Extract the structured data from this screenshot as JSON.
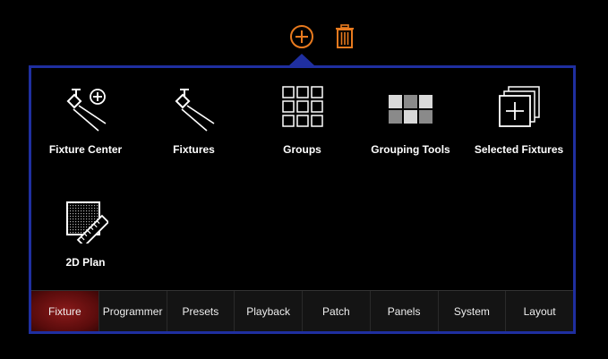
{
  "toolbar": {
    "add_icon": "add-circle-icon",
    "delete_icon": "trash-icon",
    "accent_color": "#e87a1e"
  },
  "panel": {
    "border_color": "#1f2fa0",
    "tiles": [
      {
        "label": "Fixture Center",
        "icon": "fixture-center-icon"
      },
      {
        "label": "Fixtures",
        "icon": "fixtures-icon"
      },
      {
        "label": "Groups",
        "icon": "groups-icon"
      },
      {
        "label": "Grouping Tools",
        "icon": "grouping-tools-icon"
      },
      {
        "label": "Selected Fixtures",
        "icon": "selected-fixtures-icon"
      },
      {
        "label": "2D Plan",
        "icon": "2d-plan-icon"
      }
    ]
  },
  "tabs": {
    "active": "Fixture",
    "items": [
      "Fixture",
      "Programmer",
      "Presets",
      "Playback",
      "Patch",
      "Panels",
      "System",
      "Layout"
    ]
  }
}
